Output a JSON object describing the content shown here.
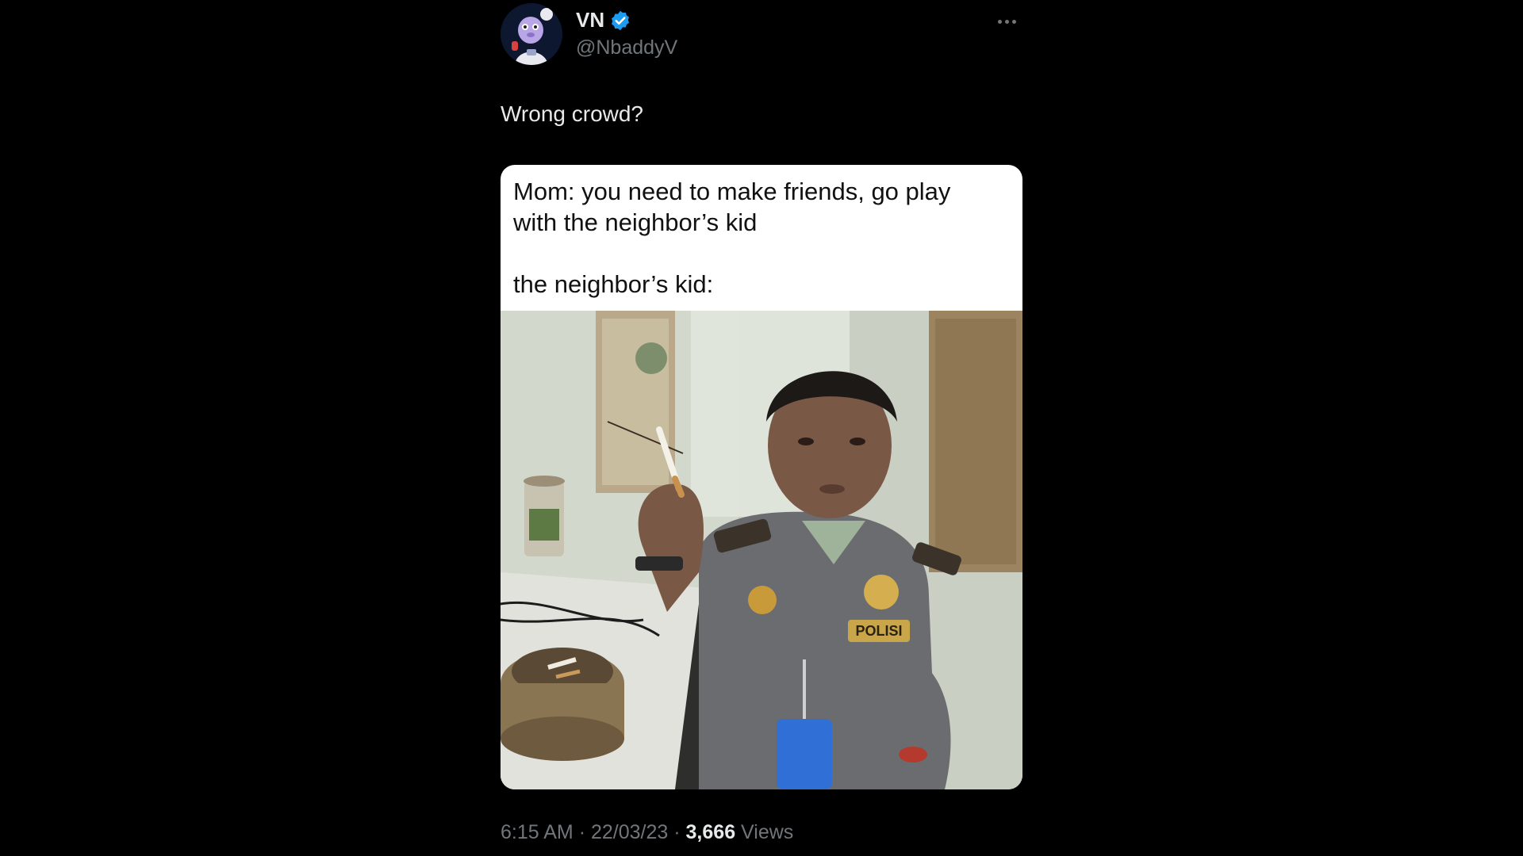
{
  "author": {
    "display_name": "VN",
    "handle": "@NbaddyV",
    "verified_icon": "verified-badge-icon",
    "verified_color": "#1d9bf0"
  },
  "tweet": {
    "text": "Wrong crowd?"
  },
  "meme": {
    "line1": "Mom: you need to make friends, go play",
    "line2": "with the neighbor’s kid",
    "line3": "the neighbor’s kid:",
    "photo_badge": "POLISI"
  },
  "meta": {
    "time": "6:15 AM",
    "separator": "·",
    "date": "22/03/23",
    "views_count": "3,666",
    "views_label": "Views"
  },
  "colors": {
    "background": "#000000",
    "primary_text": "#e7e9ea",
    "secondary_text": "#71767b"
  }
}
